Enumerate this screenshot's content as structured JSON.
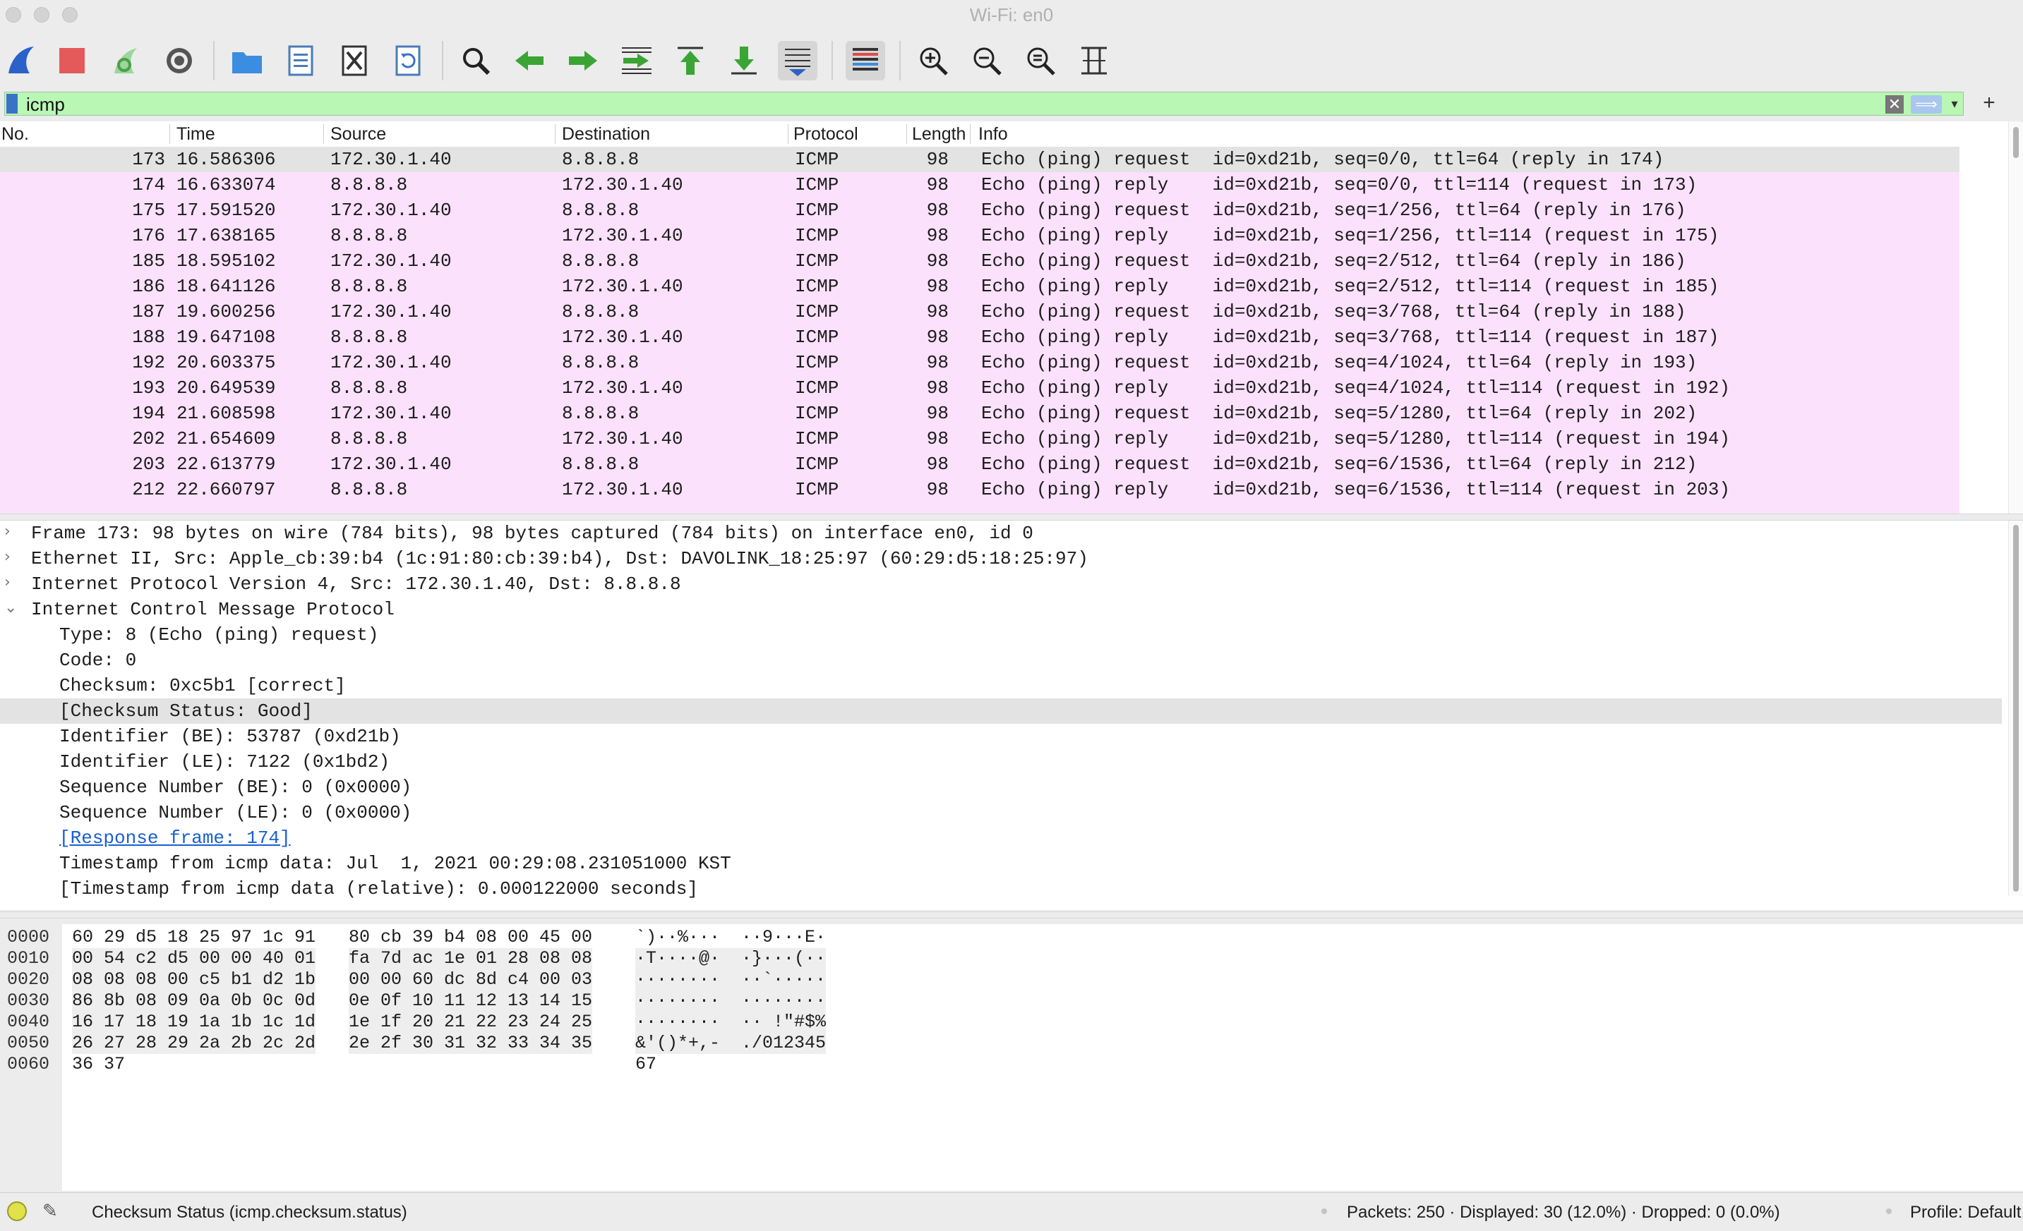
{
  "window": {
    "title": "Wi-Fi: en0"
  },
  "toolbar": {
    "buttons": [
      {
        "name": "start-capture-icon"
      },
      {
        "name": "stop-capture-icon"
      },
      {
        "name": "restart-capture-icon"
      },
      {
        "name": "capture-options-icon"
      },
      {
        "name": "open-file-icon"
      },
      {
        "name": "save-file-icon"
      },
      {
        "name": "close-file-icon"
      },
      {
        "name": "reload-file-icon"
      },
      {
        "name": "find-packet-icon"
      },
      {
        "name": "go-back-icon"
      },
      {
        "name": "go-forward-icon"
      },
      {
        "name": "go-to-packet-icon"
      },
      {
        "name": "go-first-packet-icon"
      },
      {
        "name": "go-last-packet-icon"
      },
      {
        "name": "auto-scroll-icon"
      },
      {
        "name": "colorize-icon"
      },
      {
        "name": "zoom-in-icon"
      },
      {
        "name": "zoom-out-icon"
      },
      {
        "name": "normal-size-icon"
      },
      {
        "name": "resize-columns-icon"
      }
    ]
  },
  "filter": {
    "value": "icmp"
  },
  "packet_list": {
    "columns": [
      "No.",
      "Time",
      "Source",
      "Destination",
      "Protocol",
      "Length",
      "Info"
    ],
    "rows": [
      {
        "no": "173",
        "time": "16.586306",
        "src": "172.30.1.40",
        "dst": "8.8.8.8",
        "proto": "ICMP",
        "len": "98",
        "info": "Echo (ping) request  id=0xd21b, seq=0/0, ttl=64 (reply in 174)"
      },
      {
        "no": "174",
        "time": "16.633074",
        "src": "8.8.8.8",
        "dst": "172.30.1.40",
        "proto": "ICMP",
        "len": "98",
        "info": "Echo (ping) reply    id=0xd21b, seq=0/0, ttl=114 (request in 173)"
      },
      {
        "no": "175",
        "time": "17.591520",
        "src": "172.30.1.40",
        "dst": "8.8.8.8",
        "proto": "ICMP",
        "len": "98",
        "info": "Echo (ping) request  id=0xd21b, seq=1/256, ttl=64 (reply in 176)"
      },
      {
        "no": "176",
        "time": "17.638165",
        "src": "8.8.8.8",
        "dst": "172.30.1.40",
        "proto": "ICMP",
        "len": "98",
        "info": "Echo (ping) reply    id=0xd21b, seq=1/256, ttl=114 (request in 175)"
      },
      {
        "no": "185",
        "time": "18.595102",
        "src": "172.30.1.40",
        "dst": "8.8.8.8",
        "proto": "ICMP",
        "len": "98",
        "info": "Echo (ping) request  id=0xd21b, seq=2/512, ttl=64 (reply in 186)"
      },
      {
        "no": "186",
        "time": "18.641126",
        "src": "8.8.8.8",
        "dst": "172.30.1.40",
        "proto": "ICMP",
        "len": "98",
        "info": "Echo (ping) reply    id=0xd21b, seq=2/512, ttl=114 (request in 185)"
      },
      {
        "no": "187",
        "time": "19.600256",
        "src": "172.30.1.40",
        "dst": "8.8.8.8",
        "proto": "ICMP",
        "len": "98",
        "info": "Echo (ping) request  id=0xd21b, seq=3/768, ttl=64 (reply in 188)"
      },
      {
        "no": "188",
        "time": "19.647108",
        "src": "8.8.8.8",
        "dst": "172.30.1.40",
        "proto": "ICMP",
        "len": "98",
        "info": "Echo (ping) reply    id=0xd21b, seq=3/768, ttl=114 (request in 187)"
      },
      {
        "no": "192",
        "time": "20.603375",
        "src": "172.30.1.40",
        "dst": "8.8.8.8",
        "proto": "ICMP",
        "len": "98",
        "info": "Echo (ping) request  id=0xd21b, seq=4/1024, ttl=64 (reply in 193)"
      },
      {
        "no": "193",
        "time": "20.649539",
        "src": "8.8.8.8",
        "dst": "172.30.1.40",
        "proto": "ICMP",
        "len": "98",
        "info": "Echo (ping) reply    id=0xd21b, seq=4/1024, ttl=114 (request in 192)"
      },
      {
        "no": "194",
        "time": "21.608598",
        "src": "172.30.1.40",
        "dst": "8.8.8.8",
        "proto": "ICMP",
        "len": "98",
        "info": "Echo (ping) request  id=0xd21b, seq=5/1280, ttl=64 (reply in 202)"
      },
      {
        "no": "202",
        "time": "21.654609",
        "src": "8.8.8.8",
        "dst": "172.30.1.40",
        "proto": "ICMP",
        "len": "98",
        "info": "Echo (ping) reply    id=0xd21b, seq=5/1280, ttl=114 (request in 194)"
      },
      {
        "no": "203",
        "time": "22.613779",
        "src": "172.30.1.40",
        "dst": "8.8.8.8",
        "proto": "ICMP",
        "len": "98",
        "info": "Echo (ping) request  id=0xd21b, seq=6/1536, ttl=64 (reply in 212)"
      },
      {
        "no": "212",
        "time": "22.660797",
        "src": "8.8.8.8",
        "dst": "172.30.1.40",
        "proto": "ICMP",
        "len": "98",
        "info": "Echo (ping) reply    id=0xd21b, seq=6/1536, ttl=114 (request in 203)"
      }
    ]
  },
  "details": {
    "lines": [
      {
        "text": "Frame 173: 98 bytes on wire (784 bits), 98 bytes captured (784 bits) on interface en0, id 0",
        "arrow": "›"
      },
      {
        "text": "Ethernet II, Src: Apple_cb:39:b4 (1c:91:80:cb:39:b4), Dst: DAVOLINK_18:25:97 (60:29:d5:18:25:97)",
        "arrow": "›"
      },
      {
        "text": "Internet Protocol Version 4, Src: 172.30.1.40, Dst: 8.8.8.8",
        "arrow": "›"
      },
      {
        "text": "Internet Control Message Protocol",
        "arrow": "⌄"
      },
      {
        "text": "Type: 8 (Echo (ping) request)",
        "arrow": ""
      },
      {
        "text": "Code: 0",
        "arrow": ""
      },
      {
        "text": "Checksum: 0xc5b1 [correct]",
        "arrow": ""
      },
      {
        "text": "[Checksum Status: Good]",
        "arrow": ""
      },
      {
        "text": "Identifier (BE): 53787 (0xd21b)",
        "arrow": ""
      },
      {
        "text": "Identifier (LE): 7122 (0x1bd2)",
        "arrow": ""
      },
      {
        "text": "Sequence Number (BE): 0 (0x0000)",
        "arrow": ""
      },
      {
        "text": "Sequence Number (LE): 0 (0x0000)",
        "arrow": ""
      },
      {
        "text": "[Response frame: 174]",
        "arrow": ""
      },
      {
        "text": "Timestamp from icmp data: Jul  1, 2021 00:29:08.231051000 KST",
        "arrow": ""
      },
      {
        "text": "[Timestamp from icmp data (relative): 0.000122000 seconds]",
        "arrow": ""
      }
    ]
  },
  "bytes": {
    "rows": [
      {
        "offset": "0000",
        "hex1": "60 29 d5 18 25 97 1c 91",
        "hex2": "80 cb 39 b4 08 00 45 00",
        "ascii": "`)··%···  ··9···E·"
      },
      {
        "offset": "0010",
        "hex1": "00 54 c2 d5 00 00 40 01",
        "hex2": "fa 7d ac 1e 01 28 08 08",
        "ascii": "·T····@·  ·}···(··"
      },
      {
        "offset": "0020",
        "hex1": "08 08 08 00 c5 b1 d2 1b",
        "hex2": "00 00 60 dc 8d c4 00 03",
        "ascii": "········  ··`·····"
      },
      {
        "offset": "0030",
        "hex1": "86 8b 08 09 0a 0b 0c 0d",
        "hex2": "0e 0f 10 11 12 13 14 15",
        "ascii": "········  ········"
      },
      {
        "offset": "0040",
        "hex1": "16 17 18 19 1a 1b 1c 1d",
        "hex2": "1e 1f 20 21 22 23 24 25",
        "ascii": "········  ·· !\"#$%"
      },
      {
        "offset": "0050",
        "hex1": "26 27 28 29 2a 2b 2c 2d",
        "hex2": "2e 2f 30 31 32 33 34 35",
        "ascii": "&'()*+,-  ./012345"
      },
      {
        "offset": "0060",
        "hex1": "36 37",
        "hex2": "",
        "ascii": "67"
      }
    ]
  },
  "status": {
    "field": "Checksum Status (icmp.checksum.status)",
    "packets": "Packets: 250 · Displayed: 30 (12.0%) · Dropped: 0 (0.0%)",
    "profile": "Profile: Default"
  }
}
